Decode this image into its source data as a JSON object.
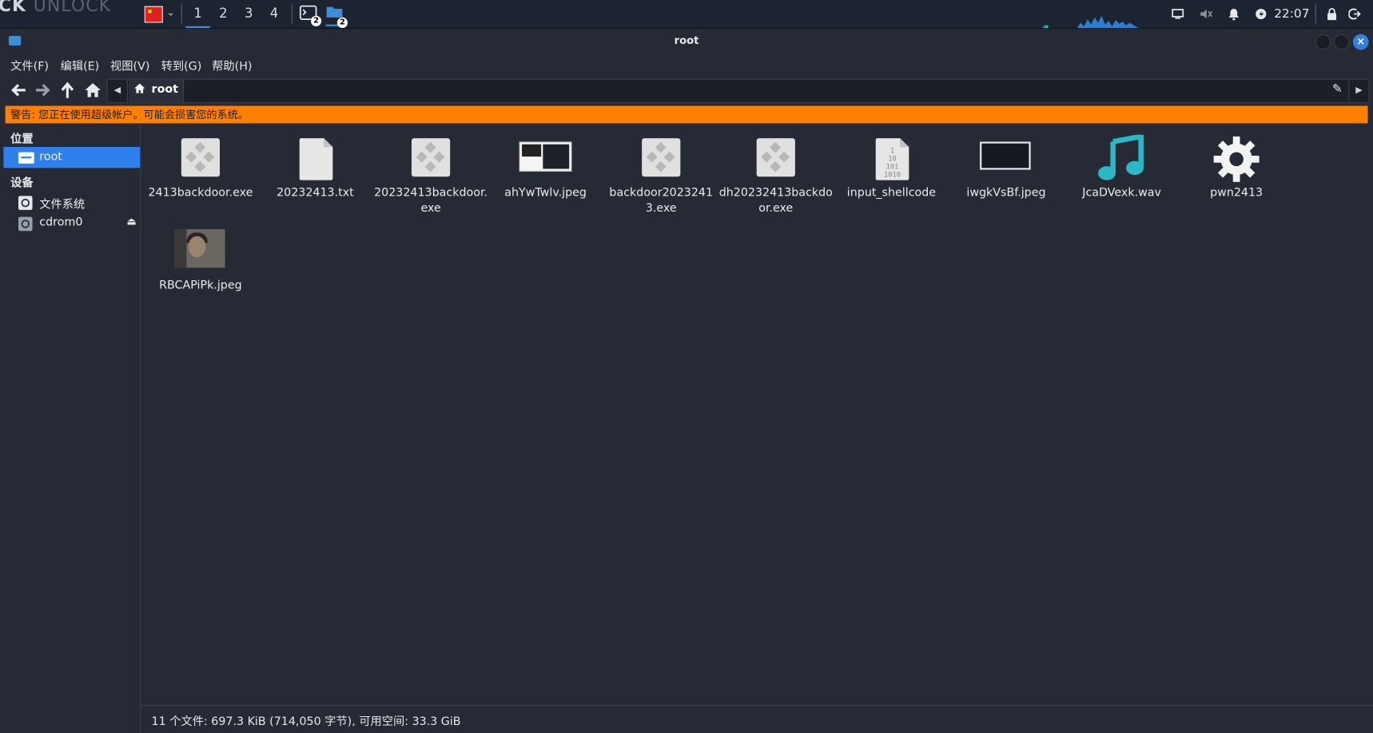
{
  "panel": {
    "brand": "CK",
    "brand_dim": "UNLOCK",
    "workspaces": [
      "1",
      "2",
      "3",
      "4"
    ],
    "task_badges": [
      "2",
      "2"
    ],
    "clock": "22:07"
  },
  "window": {
    "title": "root"
  },
  "menubar": [
    "文件(F)",
    "编辑(E)",
    "视图(V)",
    "转到(G)",
    "帮助(H)"
  ],
  "path": {
    "current": "root"
  },
  "warning": "警告: 您正在使用超级帐户。可能会损害您的系统。",
  "sidebar": {
    "places_header": "位置",
    "places": [
      {
        "label": "root",
        "selected": true
      }
    ],
    "devices_header": "设备",
    "devices": [
      {
        "label": "文件系统"
      },
      {
        "label": "cdrom0",
        "ejectable": true
      }
    ]
  },
  "files": [
    {
      "name": "2413backdoor.exe",
      "icon": "exe-icon"
    },
    {
      "name": "20232413.txt",
      "icon": "text-file-icon"
    },
    {
      "name": "20232413backdoor.exe",
      "icon": "exe-icon"
    },
    {
      "name": "ahYwTwlv.jpeg",
      "icon": "image-thumbnail-icon"
    },
    {
      "name": "backdoor20232413.exe",
      "icon": "exe-icon"
    },
    {
      "name": "dh20232413backdoor.exe",
      "icon": "exe-icon"
    },
    {
      "name": "input_shellcode",
      "icon": "binary-file-icon"
    },
    {
      "name": "iwgkVsBf.jpeg",
      "icon": "image-thumbnail-icon"
    },
    {
      "name": "JcaDVexk.wav",
      "icon": "audio-file-icon"
    },
    {
      "name": "pwn2413",
      "icon": "executable-gear-icon"
    },
    {
      "name": "RBCAPiPk.jpeg",
      "icon": "photo-thumbnail-icon"
    }
  ],
  "status": "11 个文件: 697.3 KiB (714,050 字节), 可用空间: 33.3 GiB",
  "colors": {
    "accent": "#2f80ed",
    "warning_bg": "#ff8000",
    "background": "#262a34"
  }
}
